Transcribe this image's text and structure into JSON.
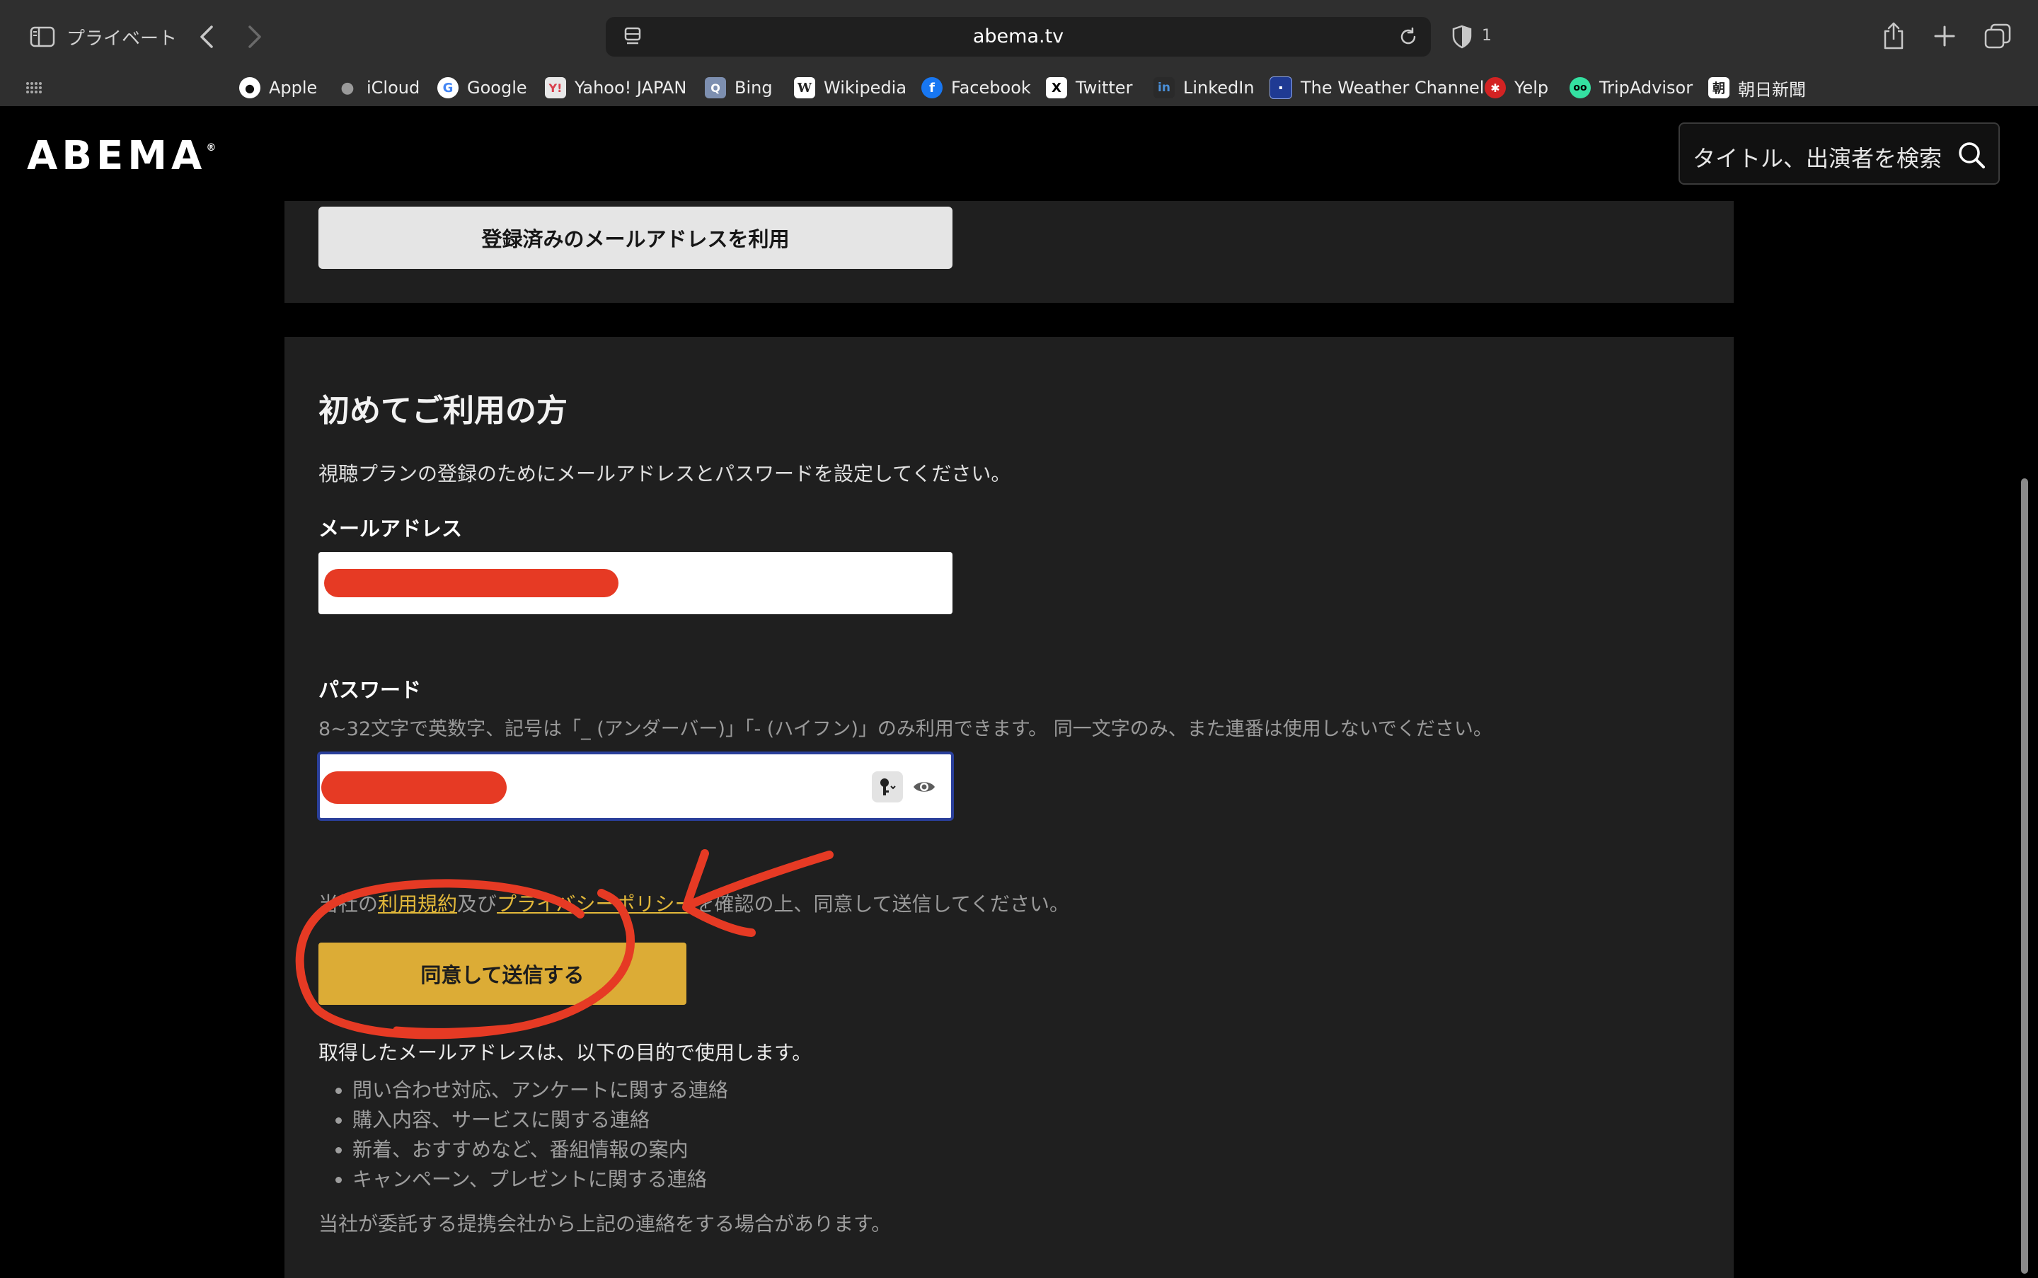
{
  "browser": {
    "private_label": "プライベート",
    "url": "abema.tv",
    "tracker_count": "1",
    "bookmarks": [
      {
        "label": "Apple",
        "icon": "apple-icon",
        "color": "#ffffff"
      },
      {
        "label": "iCloud",
        "icon": "apple-icon",
        "color": "#9a9a9a"
      },
      {
        "label": "Google",
        "icon": "google-icon",
        "color": "#ffffff"
      },
      {
        "label": "Yahoo! JAPAN",
        "icon": "yahoo-icon",
        "color": "#d9404d"
      },
      {
        "label": "Bing",
        "icon": "bing-icon",
        "color": "#7d8fb0"
      },
      {
        "label": "Wikipedia",
        "icon": "wikipedia-icon",
        "color": "#ffffff"
      },
      {
        "label": "Facebook",
        "icon": "facebook-icon",
        "color": "#1877f2"
      },
      {
        "label": "Twitter",
        "icon": "x-icon",
        "color": "#ffffff"
      },
      {
        "label": "LinkedIn",
        "icon": "linkedin-icon",
        "color": "#0a66c2"
      },
      {
        "label": "The Weather Channel",
        "icon": "weather-channel-icon",
        "color": "#1f3a93"
      },
      {
        "label": "Yelp",
        "icon": "yelp-icon",
        "color": "#d32323"
      },
      {
        "label": "TripAdvisor",
        "icon": "tripadvisor-icon",
        "color": "#34e0a1"
      },
      {
        "label": "朝日新聞",
        "icon": "asahi-icon",
        "color": "#ffffff"
      }
    ]
  },
  "header": {
    "logo": "ABEMA",
    "search_placeholder": "タイトル、出演者を検索"
  },
  "existing": {
    "button_label": "登録済みのメールアドレスを利用"
  },
  "signup": {
    "title": "初めてご利用の方",
    "description": "視聴プランの登録のためにメールアドレスとパスワードを設定してください。",
    "email_label": "メールアドレス",
    "password_label": "パスワード",
    "password_hint": "8~32文字で英数字、記号は「_ (アンダーバー)」「- (ハイフン)」のみ利用できます。 同一文字のみ、また連番は使用しないでください。",
    "consent_prefix": "当社の",
    "terms_link": "利用規約",
    "consent_and": "及び",
    "privacy_link": "プライバシーポリシー",
    "consent_suffix": "を確認の上、同意して送信してください。",
    "submit_label": "同意して送信する",
    "purpose_intro": "取得したメールアドレスは、以下の目的で使用します。",
    "purposes": [
      "問い合わせ対応、アンケートに関する連絡",
      "購入内容、サービスに関する連絡",
      "新着、おすすめなど、番組情報の案内",
      "キャンペーン、プレゼントに関する連絡"
    ],
    "purpose_note": "当社が委託する提携会社から上記の連絡をする場合があります。"
  },
  "colors": {
    "accent": "#dcac36",
    "link": "#e2b83a",
    "annotation": "#e63a24",
    "focus": "#2a3f9a"
  }
}
